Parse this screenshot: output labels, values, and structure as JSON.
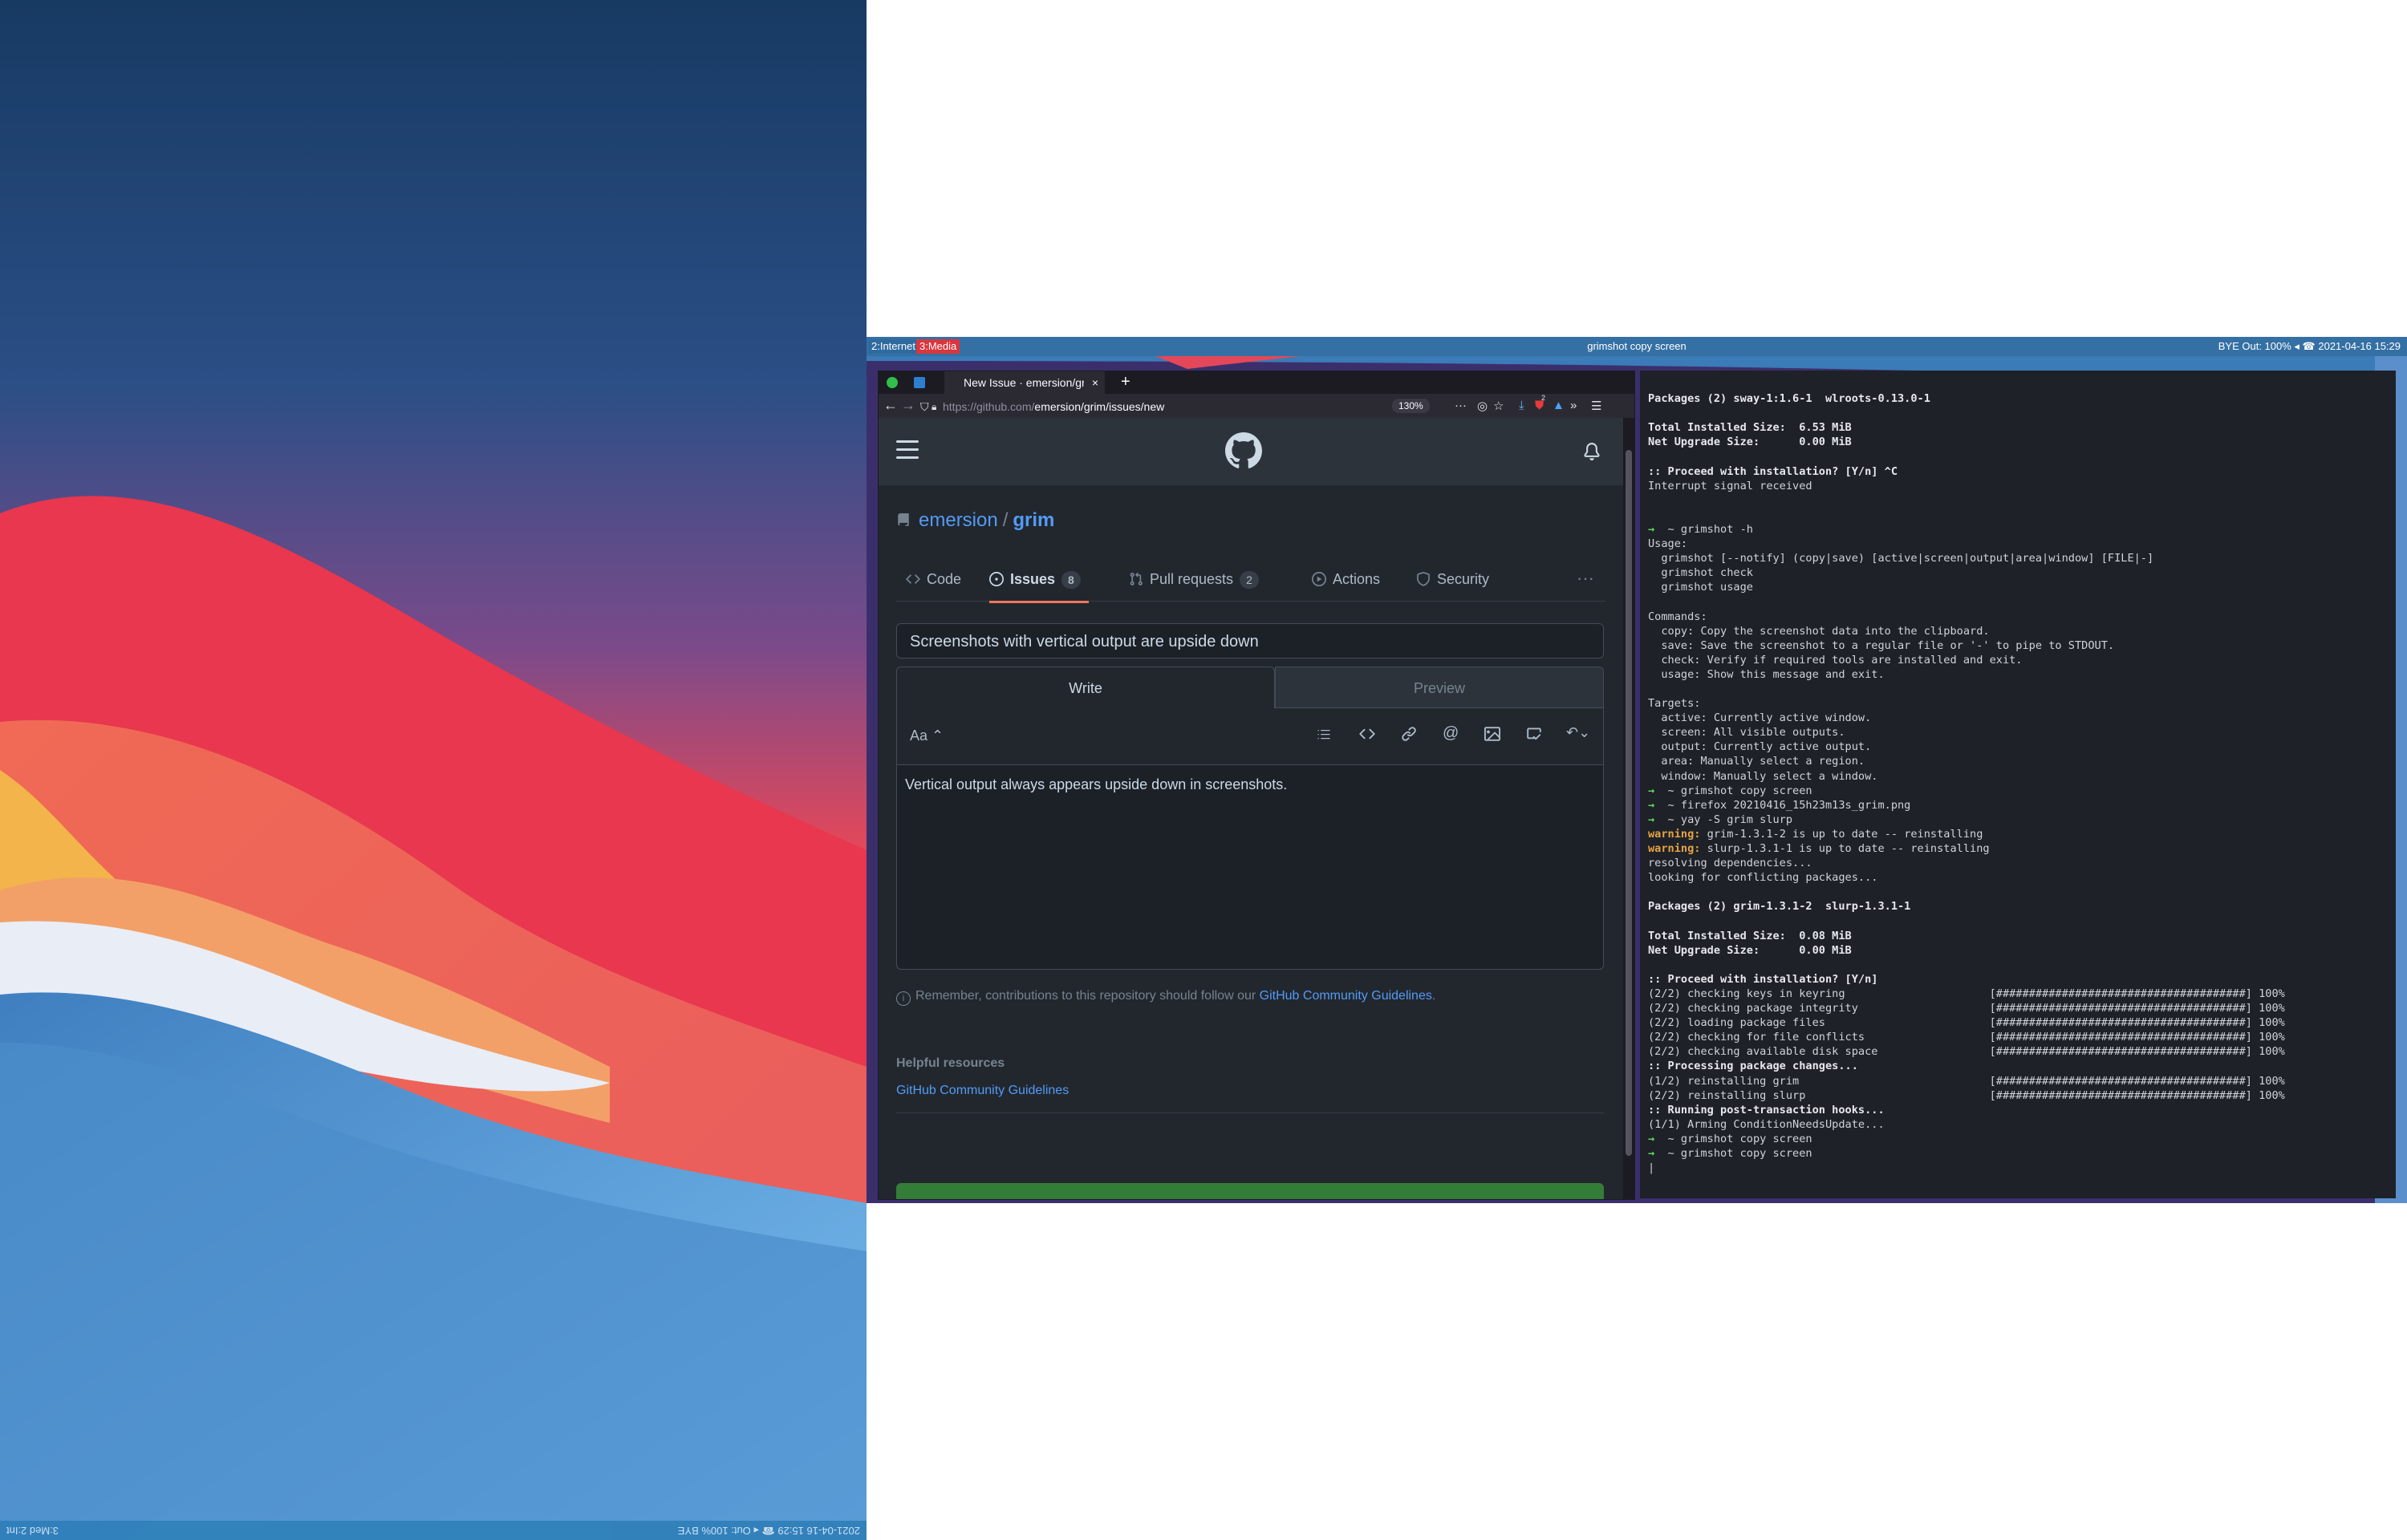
{
  "bar": {
    "workspace_1": "2:Internet",
    "workspace_2": "3:Media",
    "title": "grimshot copy screen",
    "status": "BYE  Out: 100%  ◂  ☎ 2021-04-16 15:29"
  },
  "flipped_bar": {
    "left": "2021-04-16 15:29  ☎  ◂  Out: 100%  BYE",
    "right": "3:Med  2:Int"
  },
  "browser": {
    "tab_title": "New Issue · emersion/grim",
    "tab_close": "×",
    "new_tab": "+",
    "url_prefix": "https://github.com/",
    "url_path": "emersion/grim/issues/new",
    "zoom": "130%",
    "extension_badge": "2"
  },
  "github": {
    "owner": "emersion",
    "separator": "/",
    "repo": "grim",
    "tabs": {
      "code": "Code",
      "issues": "Issues",
      "issues_count": "8",
      "pulls": "Pull requests",
      "pulls_count": "2",
      "actions": "Actions",
      "security": "Security"
    },
    "more": "···",
    "issue_title": "Screenshots with vertical output are upside down",
    "write_tab": "Write",
    "preview_tab": "Preview",
    "text_size_button": "Aa",
    "issue_body": "Vertical output always appears upside down in screenshots.",
    "remember_text": "Remember, contributions to this repository should follow our ",
    "guidelines_link": "GitHub Community Guidelines",
    "remember_end": ".",
    "helpful_heading": "Helpful resources",
    "helpful_link": "GitHub Community Guidelines"
  },
  "terminal": {
    "lines": [
      "",
      "Packages (2) sway-1:1.6-1  wlroots-0.13.0-1",
      "",
      "Total Installed Size:  6.53 MiB",
      "Net Upgrade Size:      0.00 MiB",
      "",
      ":: Proceed with installation? [Y/n] ^C",
      "Interrupt signal received",
      "",
      "",
      "→  ~ grimshot -h",
      "Usage:",
      "  grimshot [--notify] (copy|save) [active|screen|output|area|window] [FILE|-]",
      "  grimshot check",
      "  grimshot usage",
      "",
      "Commands:",
      "  copy: Copy the screenshot data into the clipboard.",
      "  save: Save the screenshot to a regular file or '-' to pipe to STDOUT.",
      "  check: Verify if required tools are installed and exit.",
      "  usage: Show this message and exit.",
      "",
      "Targets:",
      "  active: Currently active window.",
      "  screen: All visible outputs.",
      "  output: Currently active output.",
      "  area: Manually select a region.",
      "  window: Manually select a window.",
      "→  ~ grimshot copy screen",
      "→  ~ firefox 20210416_15h23m13s_grim.png",
      "→  ~ yay -S grim slurp",
      "warning: grim-1.3.1-2 is up to date -- reinstalling",
      "warning: slurp-1.3.1-1 is up to date -- reinstalling",
      "resolving dependencies...",
      "looking for conflicting packages...",
      "",
      "Packages (2) grim-1.3.1-2  slurp-1.3.1-1",
      "",
      "Total Installed Size:  0.08 MiB",
      "Net Upgrade Size:      0.00 MiB",
      "",
      ":: Proceed with installation? [Y/n]",
      "(2/2) checking keys in keyring                      [######################################] 100%",
      "(2/2) checking package integrity                    [######################################] 100%",
      "(2/2) loading package files                         [######################################] 100%",
      "(2/2) checking for file conflicts                   [######################################] 100%",
      "(2/2) checking available disk space                 [######################################] 100%",
      ":: Processing package changes...",
      "(1/2) reinstalling grim                             [######################################] 100%",
      "(2/2) reinstalling slurp                            [######################################] 100%",
      ":: Running post-transaction hooks...",
      "(1/1) Arming ConditionNeedsUpdate...",
      "→  ~ grimshot copy screen",
      "→  ~ grimshot copy screen",
      "|"
    ]
  },
  "colors": {
    "bar_blue": "#3470a4",
    "workspace_active": "#d9363e",
    "github_bg": "#22272e",
    "github_link": "#539bf5",
    "issues_underline": "#ec775c",
    "submit_green": "#347d39",
    "terminal_bg": "#1e2128",
    "terminal_warning": "#e6a342",
    "terminal_prompt": "#5fd760"
  }
}
